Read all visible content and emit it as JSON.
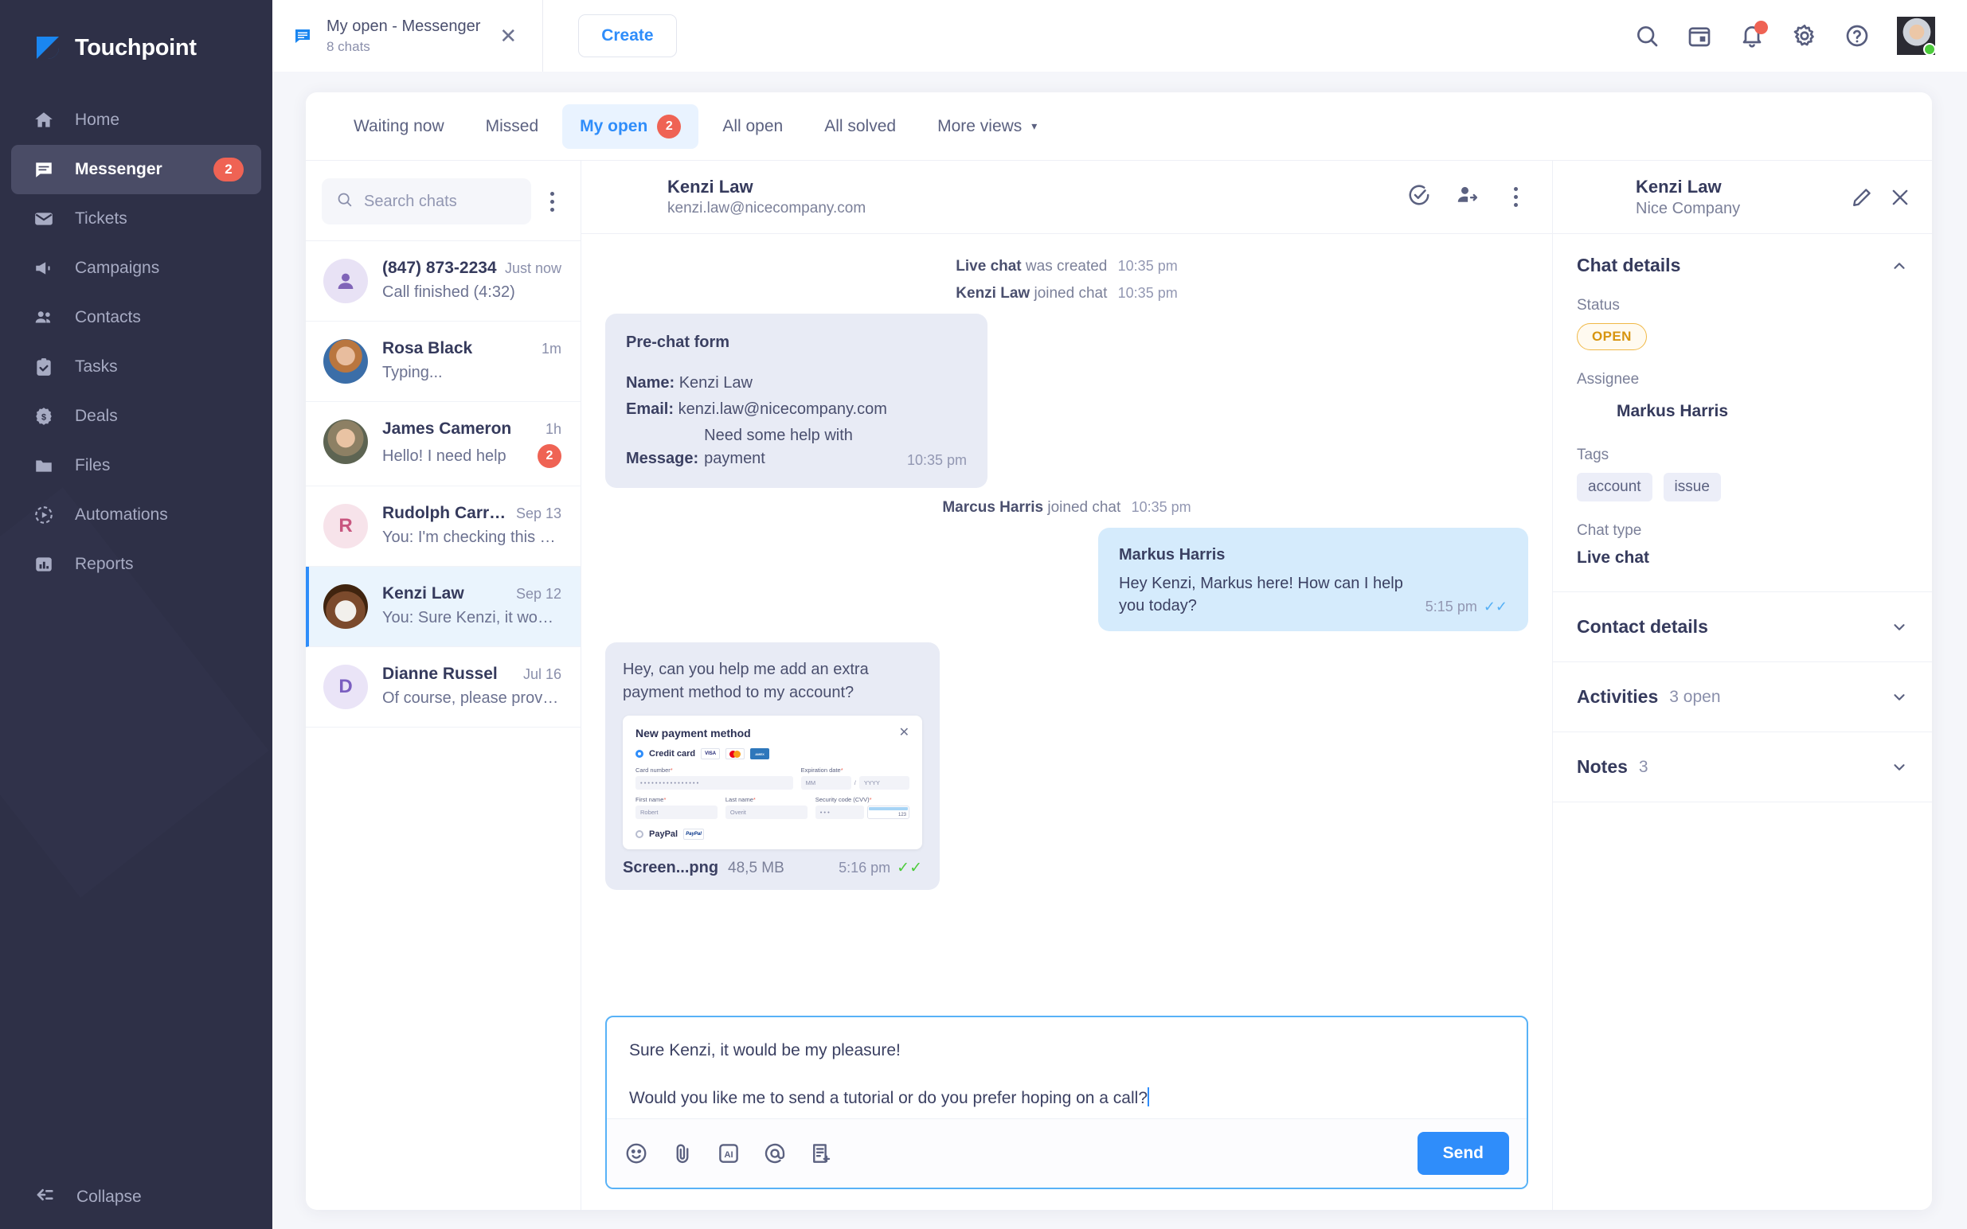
{
  "brand": {
    "name": "Touchpoint"
  },
  "sidebar": {
    "items": [
      {
        "label": "Home",
        "icon": "home-icon",
        "badge": ""
      },
      {
        "label": "Messenger",
        "icon": "messenger-icon",
        "badge": "2"
      },
      {
        "label": "Tickets",
        "icon": "mail-icon",
        "badge": ""
      },
      {
        "label": "Campaigns",
        "icon": "megaphone-icon",
        "badge": ""
      },
      {
        "label": "Contacts",
        "icon": "people-icon",
        "badge": ""
      },
      {
        "label": "Tasks",
        "icon": "clipboard-check-icon",
        "badge": ""
      },
      {
        "label": "Deals",
        "icon": "dollar-badge-icon",
        "badge": ""
      },
      {
        "label": "Files",
        "icon": "folder-icon",
        "badge": ""
      },
      {
        "label": "Automations",
        "icon": "automation-play-icon",
        "badge": ""
      },
      {
        "label": "Reports",
        "icon": "bar-chart-icon",
        "badge": ""
      }
    ],
    "collapse_label": "Collapse"
  },
  "topbar": {
    "tab": {
      "title": "My open - Messenger",
      "subtitle": "8 chats",
      "close": "✕"
    },
    "create_label": "Create",
    "icons": [
      "search-icon",
      "calendar-icon",
      "bell-icon",
      "gear-icon",
      "help-icon"
    ],
    "notification_dot": true
  },
  "views": {
    "tabs": [
      {
        "label": "Waiting now",
        "badge": "",
        "active": false
      },
      {
        "label": "Missed",
        "badge": "",
        "active": false
      },
      {
        "label": "My open",
        "badge": "2",
        "active": true
      },
      {
        "label": "All open",
        "badge": "",
        "active": false
      },
      {
        "label": "All solved",
        "badge": "",
        "active": false
      }
    ],
    "more_label": "More views",
    "more_caret": "▾"
  },
  "chat_list": {
    "search_placeholder": "Search chats",
    "search_value": "",
    "items": [
      {
        "name": "(847) 873-2234",
        "preview": "Call finished (4:32)",
        "time": "Just now",
        "badge": "",
        "avatar": "person-placeholder",
        "initial": "",
        "selected": false
      },
      {
        "name": "Rosa Black",
        "preview": "Typing...",
        "time": "1m",
        "badge": "",
        "avatar": "photo-rosa",
        "initial": "",
        "selected": false
      },
      {
        "name": "James Cameron",
        "preview": "Hello! I need help",
        "time": "1h",
        "badge": "2",
        "avatar": "photo-james",
        "initial": "",
        "selected": false
      },
      {
        "name": "Rudolph Carrera",
        "preview": "You: I'm checking this now",
        "time": "Sep 13",
        "badge": "",
        "avatar": "initial",
        "initial": "R",
        "selected": false
      },
      {
        "name": "Kenzi Law",
        "preview": "You: Sure Kenzi, it would...",
        "time": "Sep 12",
        "badge": "",
        "avatar": "photo-kenzi",
        "initial": "",
        "selected": true
      },
      {
        "name": "Dianne Russel",
        "preview": "Of course, please provide me...",
        "time": "Jul 16",
        "badge": "",
        "avatar": "initial",
        "initial": "D",
        "selected": false
      }
    ]
  },
  "conversation": {
    "header": {
      "name": "Kenzi Law",
      "email": "kenzi.law@nicecompany.com"
    },
    "system_1": {
      "bold": "Live chat",
      "rest": "was created",
      "time": "10:35 pm"
    },
    "system_2": {
      "bold": "Kenzi Law",
      "rest": "joined chat",
      "time": "10:35 pm"
    },
    "prechat": {
      "title": "Pre-chat form",
      "name_label": "Name:",
      "name_value": "Kenzi Law",
      "email_label": "Email:",
      "email_value": "kenzi.law@nicecompany.com",
      "message_label": "Message:",
      "message_value": "Need some help with payment",
      "time": "10:35 pm"
    },
    "system_3": {
      "bold": "Marcus Harris",
      "rest": "joined chat",
      "time": "10:35 pm"
    },
    "agent_msg": {
      "author": "Markus Harris",
      "text": "Hey Kenzi, Markus here! How can I help you today?",
      "time": "5:15 pm",
      "read_tick": "✓✓"
    },
    "attachment_msg": {
      "text": "Hey, can you help me add an extra payment method to my account?",
      "file_name": "Screen...png",
      "file_size": "48,5 MB",
      "time": "5:16 pm",
      "read_tick": "✓✓",
      "preview": {
        "title": "New payment method",
        "close": "✕",
        "option_card": "Credit card",
        "brands": [
          "VISA",
          "Mastercard",
          "AMEX"
        ],
        "card_number_label": "Card number",
        "card_number_value": "• • • •   • • • •   • • • •   • • • •",
        "expiration_label": "Expiration date",
        "exp_mm": "MM",
        "exp_sep": "/",
        "exp_yyyy": "YYYY",
        "first_name_label": "First name",
        "first_name_value": "Robert",
        "last_name_label": "Last name",
        "last_name_value": "Overit",
        "cvv_label": "Security code (CVV)",
        "cvv_value": "• • •",
        "cvv_hint": "123",
        "option_paypal": "PayPal",
        "required_mark": "*"
      }
    }
  },
  "composer": {
    "line1": "Sure Kenzi, it would be my pleasure!",
    "line2": "Would you like me to send a tutorial or do you prefer hoping on a call?",
    "icons": [
      "emoji-icon",
      "attachment-icon",
      "ai-icon",
      "mention-icon",
      "canned-response-icon"
    ],
    "send_label": "Send"
  },
  "details": {
    "header": {
      "name": "Kenzi Law",
      "company": "Nice Company",
      "edit_icon": "pencil-icon",
      "close_icon": "close-icon"
    },
    "chat_details": {
      "title": "Chat details",
      "status_label": "Status",
      "status_value": "OPEN",
      "assignee_label": "Assignee",
      "assignee_name": "Markus Harris",
      "tags_label": "Tags",
      "tags": [
        "account",
        "issue"
      ],
      "chat_type_label": "Chat type",
      "chat_type_value": "Live chat"
    },
    "sections": [
      {
        "title": "Contact details",
        "count": ""
      },
      {
        "title": "Activities",
        "count": "3 open"
      },
      {
        "title": "Notes",
        "count": "3"
      }
    ]
  },
  "colors": {
    "accent": "#2f8dfa",
    "sidebar": "#2e3047",
    "badge_red": "#ef6354",
    "status_open": "#d79510",
    "online_green": "#4ccb3b"
  }
}
